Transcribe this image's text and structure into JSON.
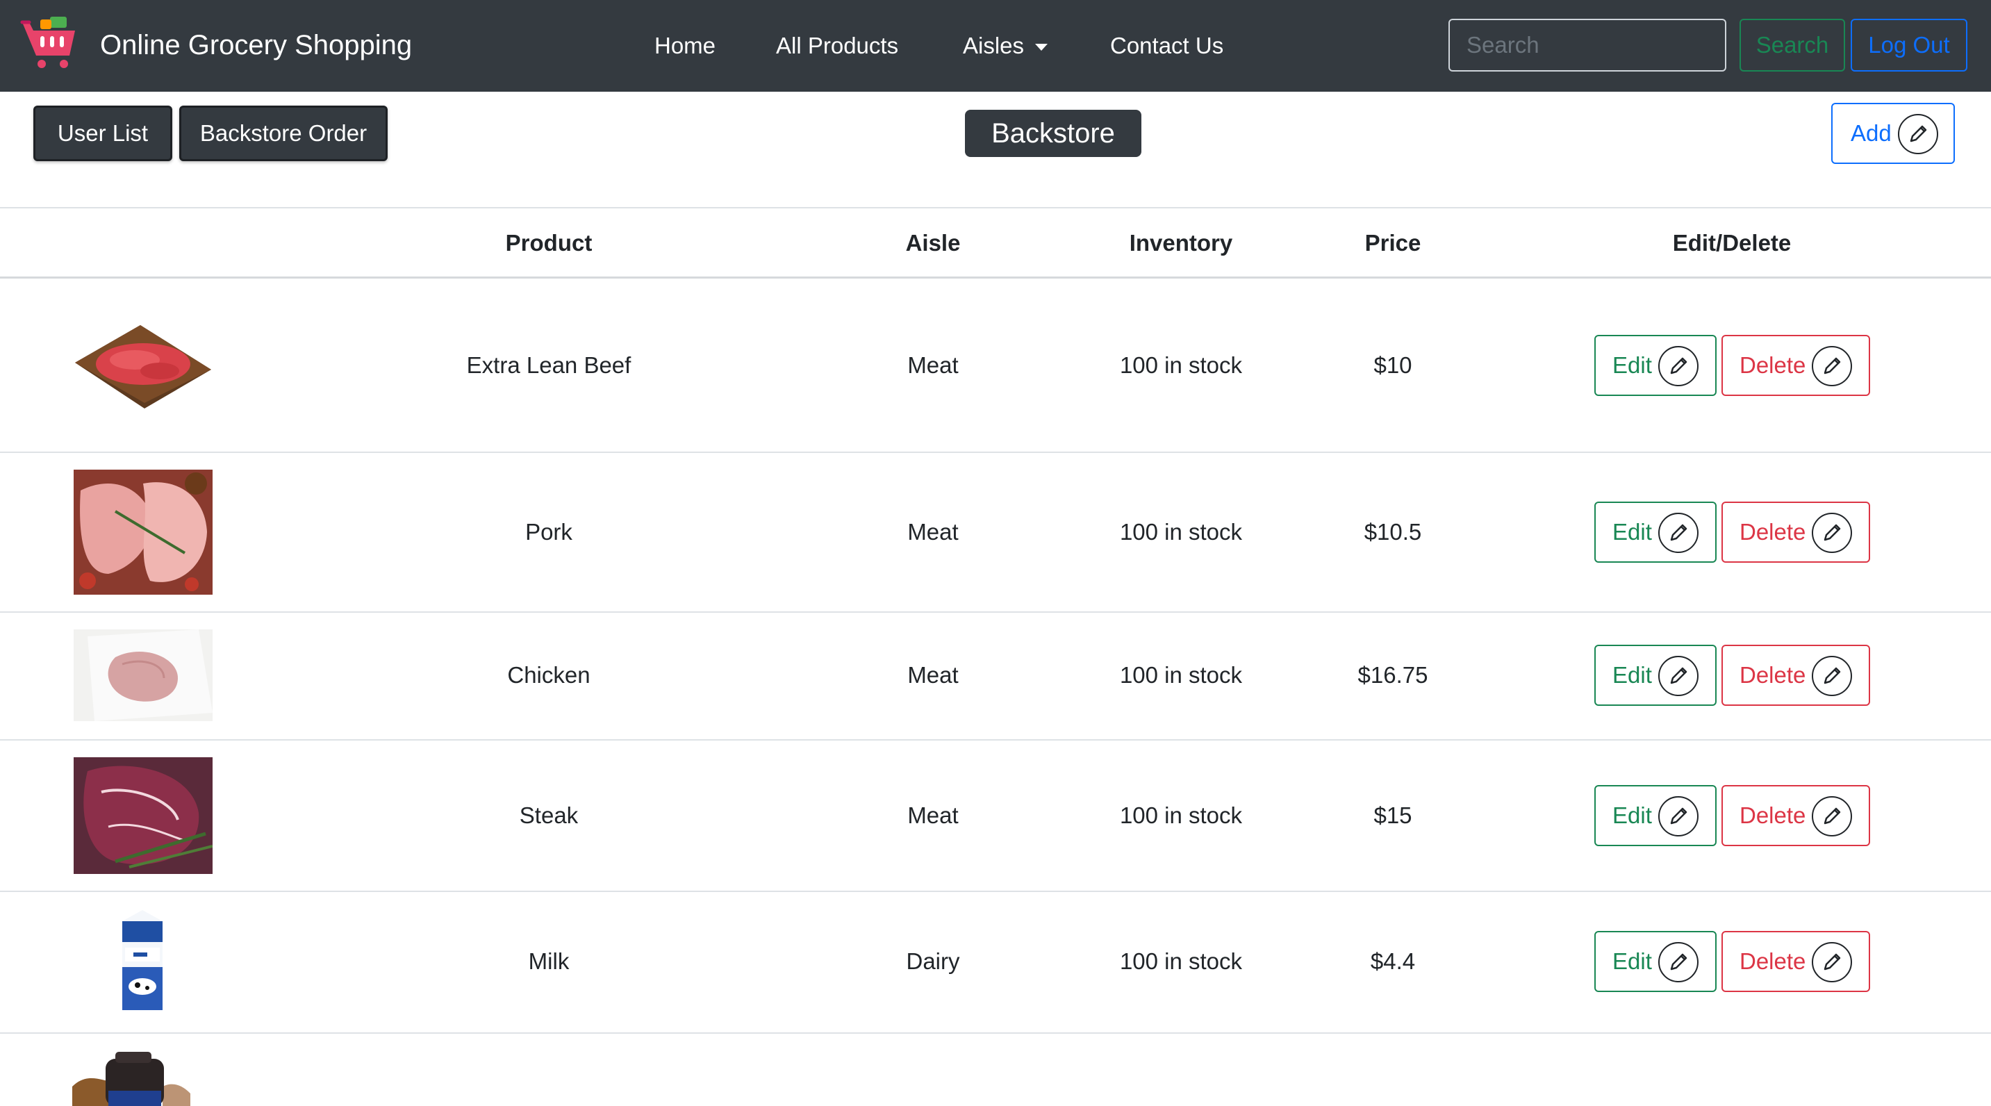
{
  "navbar": {
    "brand": "Online Grocery Shopping",
    "links": [
      "Home",
      "All Products",
      "Aisles",
      "Contact Us"
    ],
    "search_placeholder": "Search",
    "search_button": "Search",
    "logout_button": "Log Out",
    "icons": {
      "brand": "shopping-cart-icon",
      "aisles_dropdown": "caret-down-icon"
    }
  },
  "toolbar": {
    "user_list": "User List",
    "backstore_order": "Backstore Order",
    "title": "Backstore",
    "add": "Add",
    "add_icon": "pencil-icon"
  },
  "table": {
    "headers": [
      "Product",
      "Aisle",
      "Inventory",
      "Price",
      "Edit/Delete"
    ],
    "edit_label": "Edit",
    "delete_label": "Delete",
    "rows": [
      {
        "product": "Extra Lean Beef",
        "aisle": "Meat",
        "inventory": "100 in stock",
        "price": "$10",
        "image": "ground-beef-on-board-image"
      },
      {
        "product": "Pork",
        "aisle": "Meat",
        "inventory": "100 in stock",
        "price": "$10.5",
        "image": "pork-chops-image"
      },
      {
        "product": "Chicken",
        "aisle": "Meat",
        "inventory": "100 in stock",
        "price": "$16.75",
        "image": "chicken-breast-image"
      },
      {
        "product": "Steak",
        "aisle": "Meat",
        "inventory": "100 in stock",
        "price": "$15",
        "image": "steak-image"
      },
      {
        "product": "Milk",
        "aisle": "Dairy",
        "inventory": "100 in stock",
        "price": "$4.4",
        "image": "milk-carton-image"
      }
    ]
  },
  "colors": {
    "navbar_bg": "#343a40",
    "success": "#198754",
    "danger": "#dc3545",
    "primary": "#0d6efd"
  }
}
